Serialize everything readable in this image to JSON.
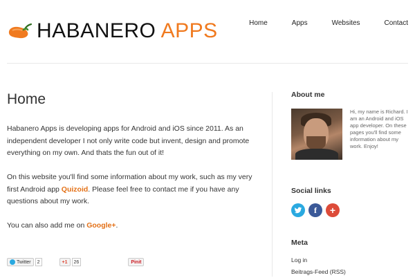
{
  "header": {
    "logo_word1": "HABANERO",
    "logo_word2": "APPS",
    "nav": [
      "Home",
      "Apps",
      "Websites",
      "Contact"
    ]
  },
  "main": {
    "title": "Home",
    "p1": "Habanero Apps is developing apps for Android and iOS since 2011. As an independent developer I not only write code but invent, design and promote everything on my own. And thats the fun out of it!",
    "p2_before": "On this website you'll find some information about my work, such as my very first Android app ",
    "p2_link": "Quizoid",
    "p2_after": ". Please feel free to contact me if you have any questions about my work.",
    "p3_before": "You can also add me on ",
    "p3_link": "Google+",
    "p3_after": ".",
    "share": {
      "twitter_label": "Twitter",
      "twitter_count": "2",
      "gplus_label": "+1",
      "gplus_count": "26",
      "pinterest_label": "Pinit"
    }
  },
  "sidebar": {
    "about_title": "About me",
    "about_text": "Hi, my name is Richard. I am an Android and iOS app developer. On these pages you'll find some information about my work. Enjoy!",
    "social_title": "Social links",
    "social_icons": [
      "twitter-icon",
      "facebook-icon",
      "google-plus-icon"
    ],
    "meta_title": "Meta",
    "meta_links": [
      "Log in",
      "Beitrags-Feed (RSS)"
    ]
  },
  "colors": {
    "accent": "#f07a1f",
    "link": "#e37016",
    "twitter": "#2aa9e0",
    "facebook": "#3b5998",
    "google": "#dd4b39"
  }
}
